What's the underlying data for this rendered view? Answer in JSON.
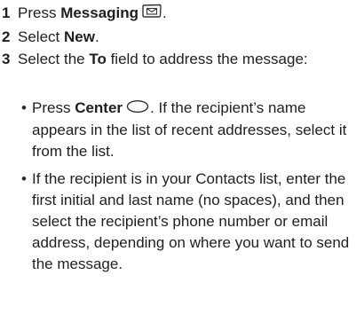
{
  "steps": [
    {
      "number": "1",
      "pre": "Press ",
      "bold": "Messaging",
      "icon": "messaging-envelope-icon",
      "post": "."
    },
    {
      "number": "2",
      "pre": "Select ",
      "bold": "New",
      "post": "."
    },
    {
      "number": "3",
      "pre": "Select the ",
      "bold": "To",
      "post": " field to address the message:"
    }
  ],
  "bullets": [
    {
      "pre": "Press ",
      "bold": "Center",
      "icon": "center-button-icon",
      "post": ". If the recipient’s name appears in the list of recent addresses, select it from the list."
    },
    {
      "text": "If the recipient is in your Contacts list, enter the first initial and last name (no spaces), and then select the recipient’s phone number or email address, depending on where you want to send the message."
    }
  ],
  "bullet_symbol": "•"
}
